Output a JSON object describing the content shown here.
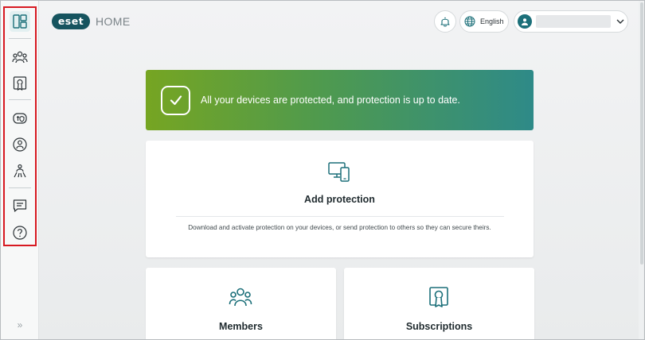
{
  "brand": {
    "logo_text": "eset",
    "product": "HOME"
  },
  "header": {
    "language": "English",
    "user_name": ""
  },
  "sidebar": {
    "items": [
      {
        "name": "dashboard",
        "icon": "dashboard-icon",
        "active": true
      },
      {
        "name": "members",
        "icon": "people-icon"
      },
      {
        "name": "subscriptions",
        "icon": "certificate-icon"
      },
      {
        "name": "devices",
        "icon": "device-shield-icon"
      },
      {
        "name": "identity",
        "icon": "user-shield-icon"
      },
      {
        "name": "parental",
        "icon": "family-icon"
      },
      {
        "name": "feedback",
        "icon": "chat-icon"
      },
      {
        "name": "help",
        "icon": "help-icon"
      }
    ],
    "expand_glyph": "»"
  },
  "banner": {
    "message": "All your devices are protected, and protection is up to date."
  },
  "cards": {
    "add_protection": {
      "title": "Add protection",
      "description": "Download and activate protection on your devices, or send protection to others so they can secure theirs."
    },
    "members": {
      "title": "Members"
    },
    "subscriptions": {
      "title": "Subscriptions"
    }
  },
  "colors": {
    "brand_teal": "#16545f",
    "accent_teal": "#1b6f79",
    "banner_start": "#76a522",
    "banner_end": "#2e8a88",
    "highlight_red": "#d71921"
  }
}
